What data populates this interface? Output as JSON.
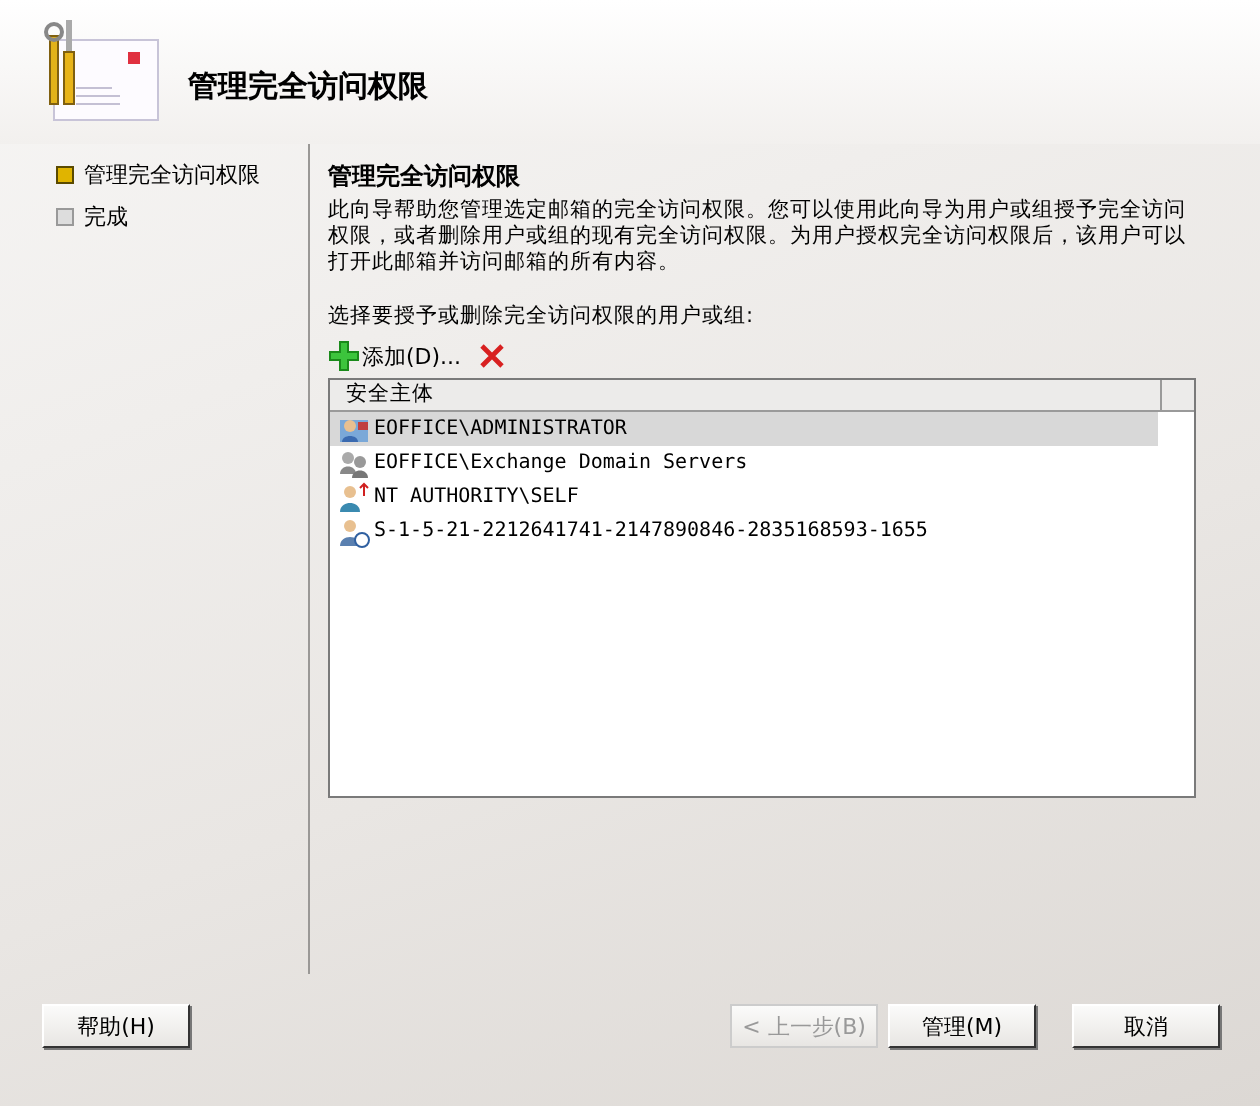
{
  "header": {
    "title": "管理完全访问权限"
  },
  "steps": [
    {
      "label": "管理完全访问权限",
      "selected": true
    },
    {
      "label": "完成",
      "selected": false
    }
  ],
  "page": {
    "heading": "管理完全访问权限",
    "description": "此向导帮助您管理选定邮箱的完全访问权限。您可以使用此向导为用户或组授予完全访问权限，或者删除用户或组的现有完全访问权限。为用户授权完全访问权限后，该用户可以打开此邮箱并访问邮箱的所有内容。",
    "prompt": "选择要授予或删除完全访问权限的用户或组:",
    "add_label": "添加(D)...",
    "column": "安全主体",
    "rows": [
      {
        "kind": "user",
        "name": "EOFFICE\\ADMINISTRATOR",
        "selected": true
      },
      {
        "kind": "group",
        "name": "EOFFICE\\Exchange Domain Servers",
        "selected": false
      },
      {
        "kind": "self",
        "name": "NT AUTHORITY\\SELF",
        "selected": false
      },
      {
        "kind": "unknown",
        "name": "S-1-5-21-2212641741-2147890846-2835168593-1655",
        "selected": false
      }
    ]
  },
  "buttons": [
    {
      "label": "帮助(H)",
      "disabled": false
    },
    {
      "label": "< 上一步(B)",
      "disabled": true
    },
    {
      "label": "管理(M)",
      "disabled": false
    },
    {
      "label": "取消",
      "disabled": false
    }
  ]
}
